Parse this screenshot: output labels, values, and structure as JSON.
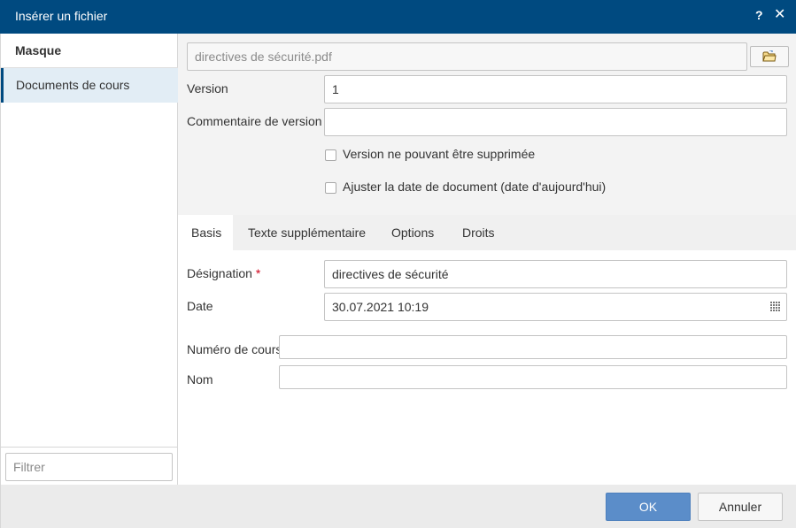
{
  "dialog": {
    "title": "Insérer un fichier",
    "help_label": "?",
    "close_label": "✕"
  },
  "sidebar": {
    "header": "Masque",
    "items": [
      {
        "label": "Documents de cours",
        "selected": true
      }
    ],
    "filter_placeholder": "Filtrer"
  },
  "file": {
    "name": "directives de sécurité.pdf",
    "browse_icon": "folder-open-icon"
  },
  "version": {
    "label": "Version",
    "value": "1"
  },
  "version_comment": {
    "label": "Commentaire de version",
    "value": ""
  },
  "checkboxes": [
    {
      "label": "Version ne pouvant être supprimée",
      "checked": false
    },
    {
      "label": "Ajuster la date de document (date d'aujourd'hui)",
      "checked": false
    }
  ],
  "tabs": [
    {
      "label": "Basis",
      "active": true
    },
    {
      "label": "Texte supplémentaire",
      "active": false
    },
    {
      "label": "Options",
      "active": false
    },
    {
      "label": "Droits",
      "active": false
    }
  ],
  "basis": {
    "designation_label": "Désignation",
    "required_marker": "*",
    "designation_value": "directives de sécurité",
    "date_label": "Date",
    "date_value": "30.07.2021 10:19",
    "course_number_label": "Numéro de cours",
    "course_number_value": "",
    "name_label": "Nom",
    "name_value": ""
  },
  "footer": {
    "ok_label": "OK",
    "cancel_label": "Annuler"
  },
  "colors": {
    "titlebar": "#004a80",
    "ok_button": "#5b8dc9",
    "selected_item": "#e2edf5",
    "required": "#d0021b"
  }
}
